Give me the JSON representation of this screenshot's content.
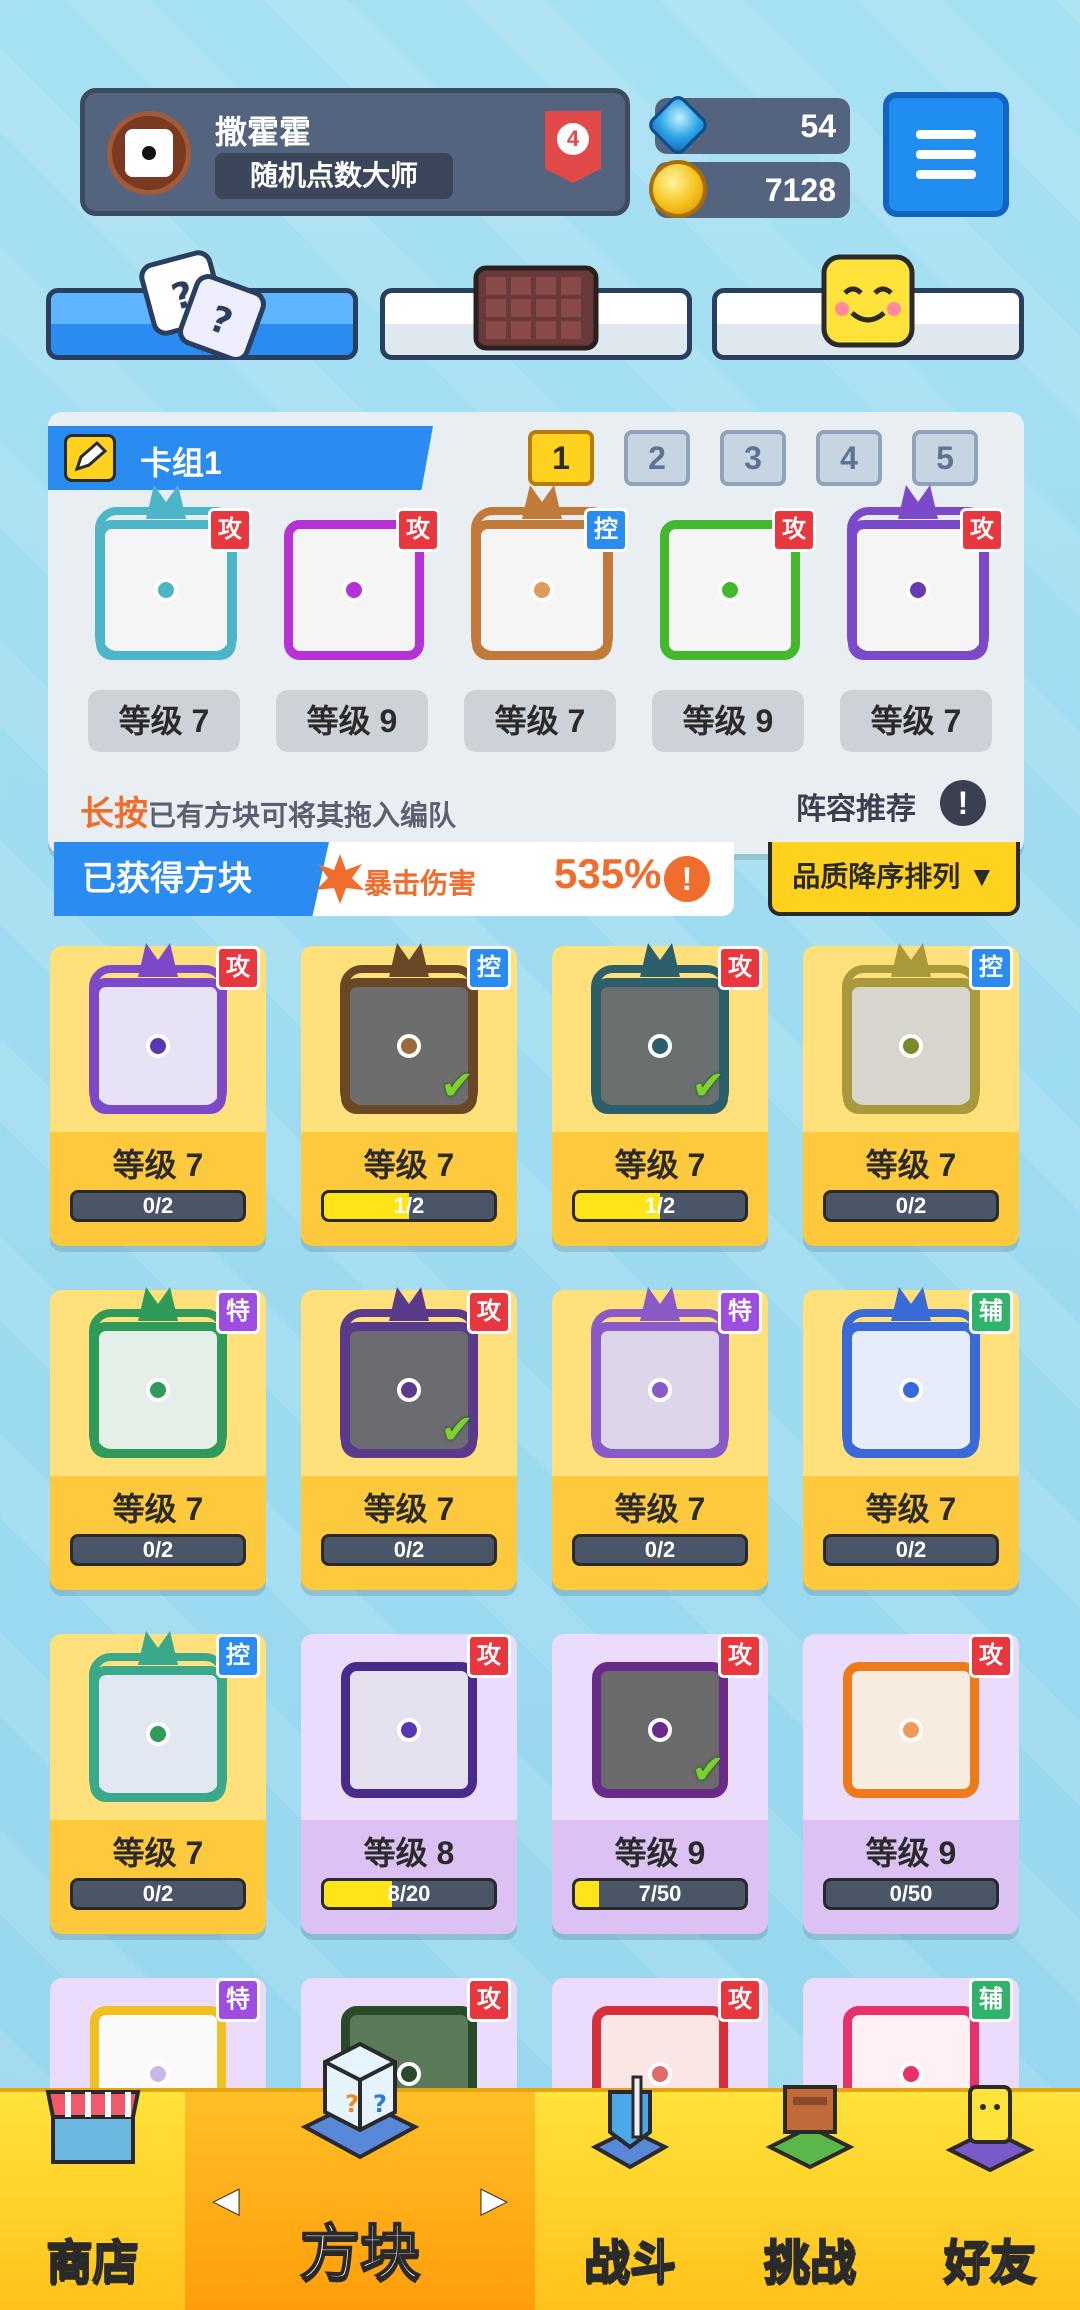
{
  "profile": {
    "name": "撒霍霍",
    "title": "随机点数大师",
    "rank": "4"
  },
  "currency": {
    "gems": "54",
    "coins": "7128"
  },
  "colors": {
    "attack": "#e8373f",
    "control": "#2a8cf0",
    "special": "#9d4de0",
    "support": "#2fb36a",
    "accent": "#2a8cf0",
    "gold": "#ffd21f"
  },
  "tabs": [
    {
      "name": "dice",
      "icon": "dice-icon"
    },
    {
      "name": "board",
      "icon": "chocolate-board-icon"
    },
    {
      "name": "emote",
      "icon": "smiley-face-icon"
    }
  ],
  "deck": {
    "name": "卡组1",
    "slots": [
      "1",
      "2",
      "3",
      "4",
      "5"
    ],
    "active_slot": "1",
    "hint_emph": "长按",
    "hint_rest": "已有方块可将其拖入编队",
    "recommend": "阵容推荐",
    "info": "!",
    "cards": [
      {
        "tag": "攻",
        "type": "atk",
        "level": "等级 7",
        "color": "#4cb5c8",
        "core": "#4cb5c8",
        "dragon": true
      },
      {
        "tag": "攻",
        "type": "atk",
        "level": "等级 9",
        "color": "#b632d6",
        "core": "#b632d6",
        "dragon": false
      },
      {
        "tag": "控",
        "type": "ctl",
        "level": "等级 7",
        "color": "#c07a3a",
        "core": "#e09a5a",
        "dragon": true
      },
      {
        "tag": "攻",
        "type": "atk",
        "level": "等级 9",
        "color": "#43b82d",
        "core": "#43b82d",
        "dragon": false
      },
      {
        "tag": "攻",
        "type": "atk",
        "level": "等级 7",
        "color": "#7c4ac8",
        "core": "#6a3bb0",
        "dragon": true
      }
    ]
  },
  "acquired": {
    "label": "已获得方块",
    "crit_label": "暴击伤害",
    "crit_value": "535%",
    "info": "!",
    "sort": "品质降序排列 ▼"
  },
  "cards": [
    {
      "tag": "攻",
      "type": "atk",
      "level": "等级 7",
      "progress": "0/2",
      "fill": 0,
      "color": "#7c4ac8",
      "face": "#e7e2f5",
      "core": "#5a37b0",
      "dragon": true,
      "check": false,
      "theme": "gold"
    },
    {
      "tag": "控",
      "type": "ctl",
      "level": "等级 7",
      "progress": "1/2",
      "fill": 0.5,
      "color": "#6a4826",
      "face": "#6d6d6d",
      "core": "#9a6a3a",
      "dragon": true,
      "check": true,
      "theme": "gold"
    },
    {
      "tag": "攻",
      "type": "atk",
      "level": "等级 7",
      "progress": "1/2",
      "fill": 0.5,
      "color": "#2c5f6a",
      "face": "#6a7070",
      "core": "#2c5f6a",
      "dragon": true,
      "check": true,
      "theme": "gold"
    },
    {
      "tag": "控",
      "type": "ctl",
      "level": "等级 7",
      "progress": "0/2",
      "fill": 0,
      "color": "#a89a3a",
      "face": "#d8d6cc",
      "core": "#7a8a2a",
      "dragon": true,
      "check": false,
      "theme": "gold"
    },
    {
      "tag": "特",
      "type": "spc",
      "level": "等级 7",
      "progress": "0/2",
      "fill": 0,
      "color": "#2f9a5a",
      "face": "#e4efe7",
      "core": "#2f9a5a",
      "dragon": true,
      "check": false,
      "theme": "gold"
    },
    {
      "tag": "攻",
      "type": "atk",
      "level": "等级 7",
      "progress": "0/2",
      "fill": 0,
      "color": "#5a3a8a",
      "face": "#6b6b72",
      "core": "#5a3a8a",
      "dragon": true,
      "check": true,
      "theme": "gold"
    },
    {
      "tag": "特",
      "type": "spc",
      "level": "等级 7",
      "progress": "0/2",
      "fill": 0,
      "color": "#8a5ac8",
      "face": "#ddd6ea",
      "core": "#8a5ac8",
      "dragon": true,
      "check": false,
      "theme": "gold"
    },
    {
      "tag": "辅",
      "type": "sup",
      "level": "等级 7",
      "progress": "0/2",
      "fill": 0,
      "color": "#3a6ad8",
      "face": "#e6ecfa",
      "core": "#3a6ad8",
      "dragon": true,
      "check": false,
      "theme": "gold"
    },
    {
      "tag": "控",
      "type": "ctl",
      "level": "等级 7",
      "progress": "0/2",
      "fill": 0,
      "color": "#3aa88a",
      "face": "#e2e8f2",
      "core": "#2f9a5a",
      "dragon": true,
      "check": false,
      "theme": "gold"
    },
    {
      "tag": "攻",
      "type": "atk",
      "level": "等级 8",
      "progress": "8/20",
      "fill": 0.4,
      "color": "#4a2a8a",
      "face": "#e4e0ee",
      "core": "#5a37b0",
      "dragon": false,
      "check": false,
      "theme": "purple"
    },
    {
      "tag": "攻",
      "type": "atk",
      "level": "等级 9",
      "progress": "7/50",
      "fill": 0.14,
      "color": "#6a2a8a",
      "face": "#6b6b6b",
      "core": "#6a2a8a",
      "dragon": false,
      "check": true,
      "theme": "purple"
    },
    {
      "tag": "攻",
      "type": "atk",
      "level": "等级 9",
      "progress": "0/50",
      "fill": 0,
      "color": "#ef7a1a",
      "face": "#f7ecdf",
      "core": "#ef9a5a",
      "dragon": false,
      "check": false,
      "theme": "purple"
    },
    {
      "tag": "特",
      "type": "spc",
      "level": "",
      "progress": "",
      "fill": 0,
      "color": "#f0c020",
      "face": "#fafafa",
      "core": "#c8b8e8",
      "dragon": false,
      "check": false,
      "theme": "purple"
    },
    {
      "tag": "攻",
      "type": "atk",
      "level": "",
      "progress": "",
      "fill": 0,
      "color": "#2a4a2a",
      "face": "#5a7a5a",
      "core": "#2a4a2a",
      "dragon": false,
      "check": false,
      "theme": "purple"
    },
    {
      "tag": "攻",
      "type": "atk",
      "level": "",
      "progress": "",
      "fill": 0,
      "color": "#d8303a",
      "face": "#fbe6e6",
      "core": "#e06a6a",
      "dragon": false,
      "check": false,
      "theme": "purple"
    },
    {
      "tag": "辅",
      "type": "sup",
      "level": "",
      "progress": "",
      "fill": 0,
      "color": "#e8306a",
      "face": "#fff0f5",
      "core": "#e8306a",
      "dragon": false,
      "check": false,
      "theme": "purple"
    }
  ],
  "nav": {
    "shop": "商店",
    "block": "方块",
    "battle": "战斗",
    "challenge": "挑战",
    "friends": "好友",
    "prev": "◀",
    "next": "▶"
  }
}
